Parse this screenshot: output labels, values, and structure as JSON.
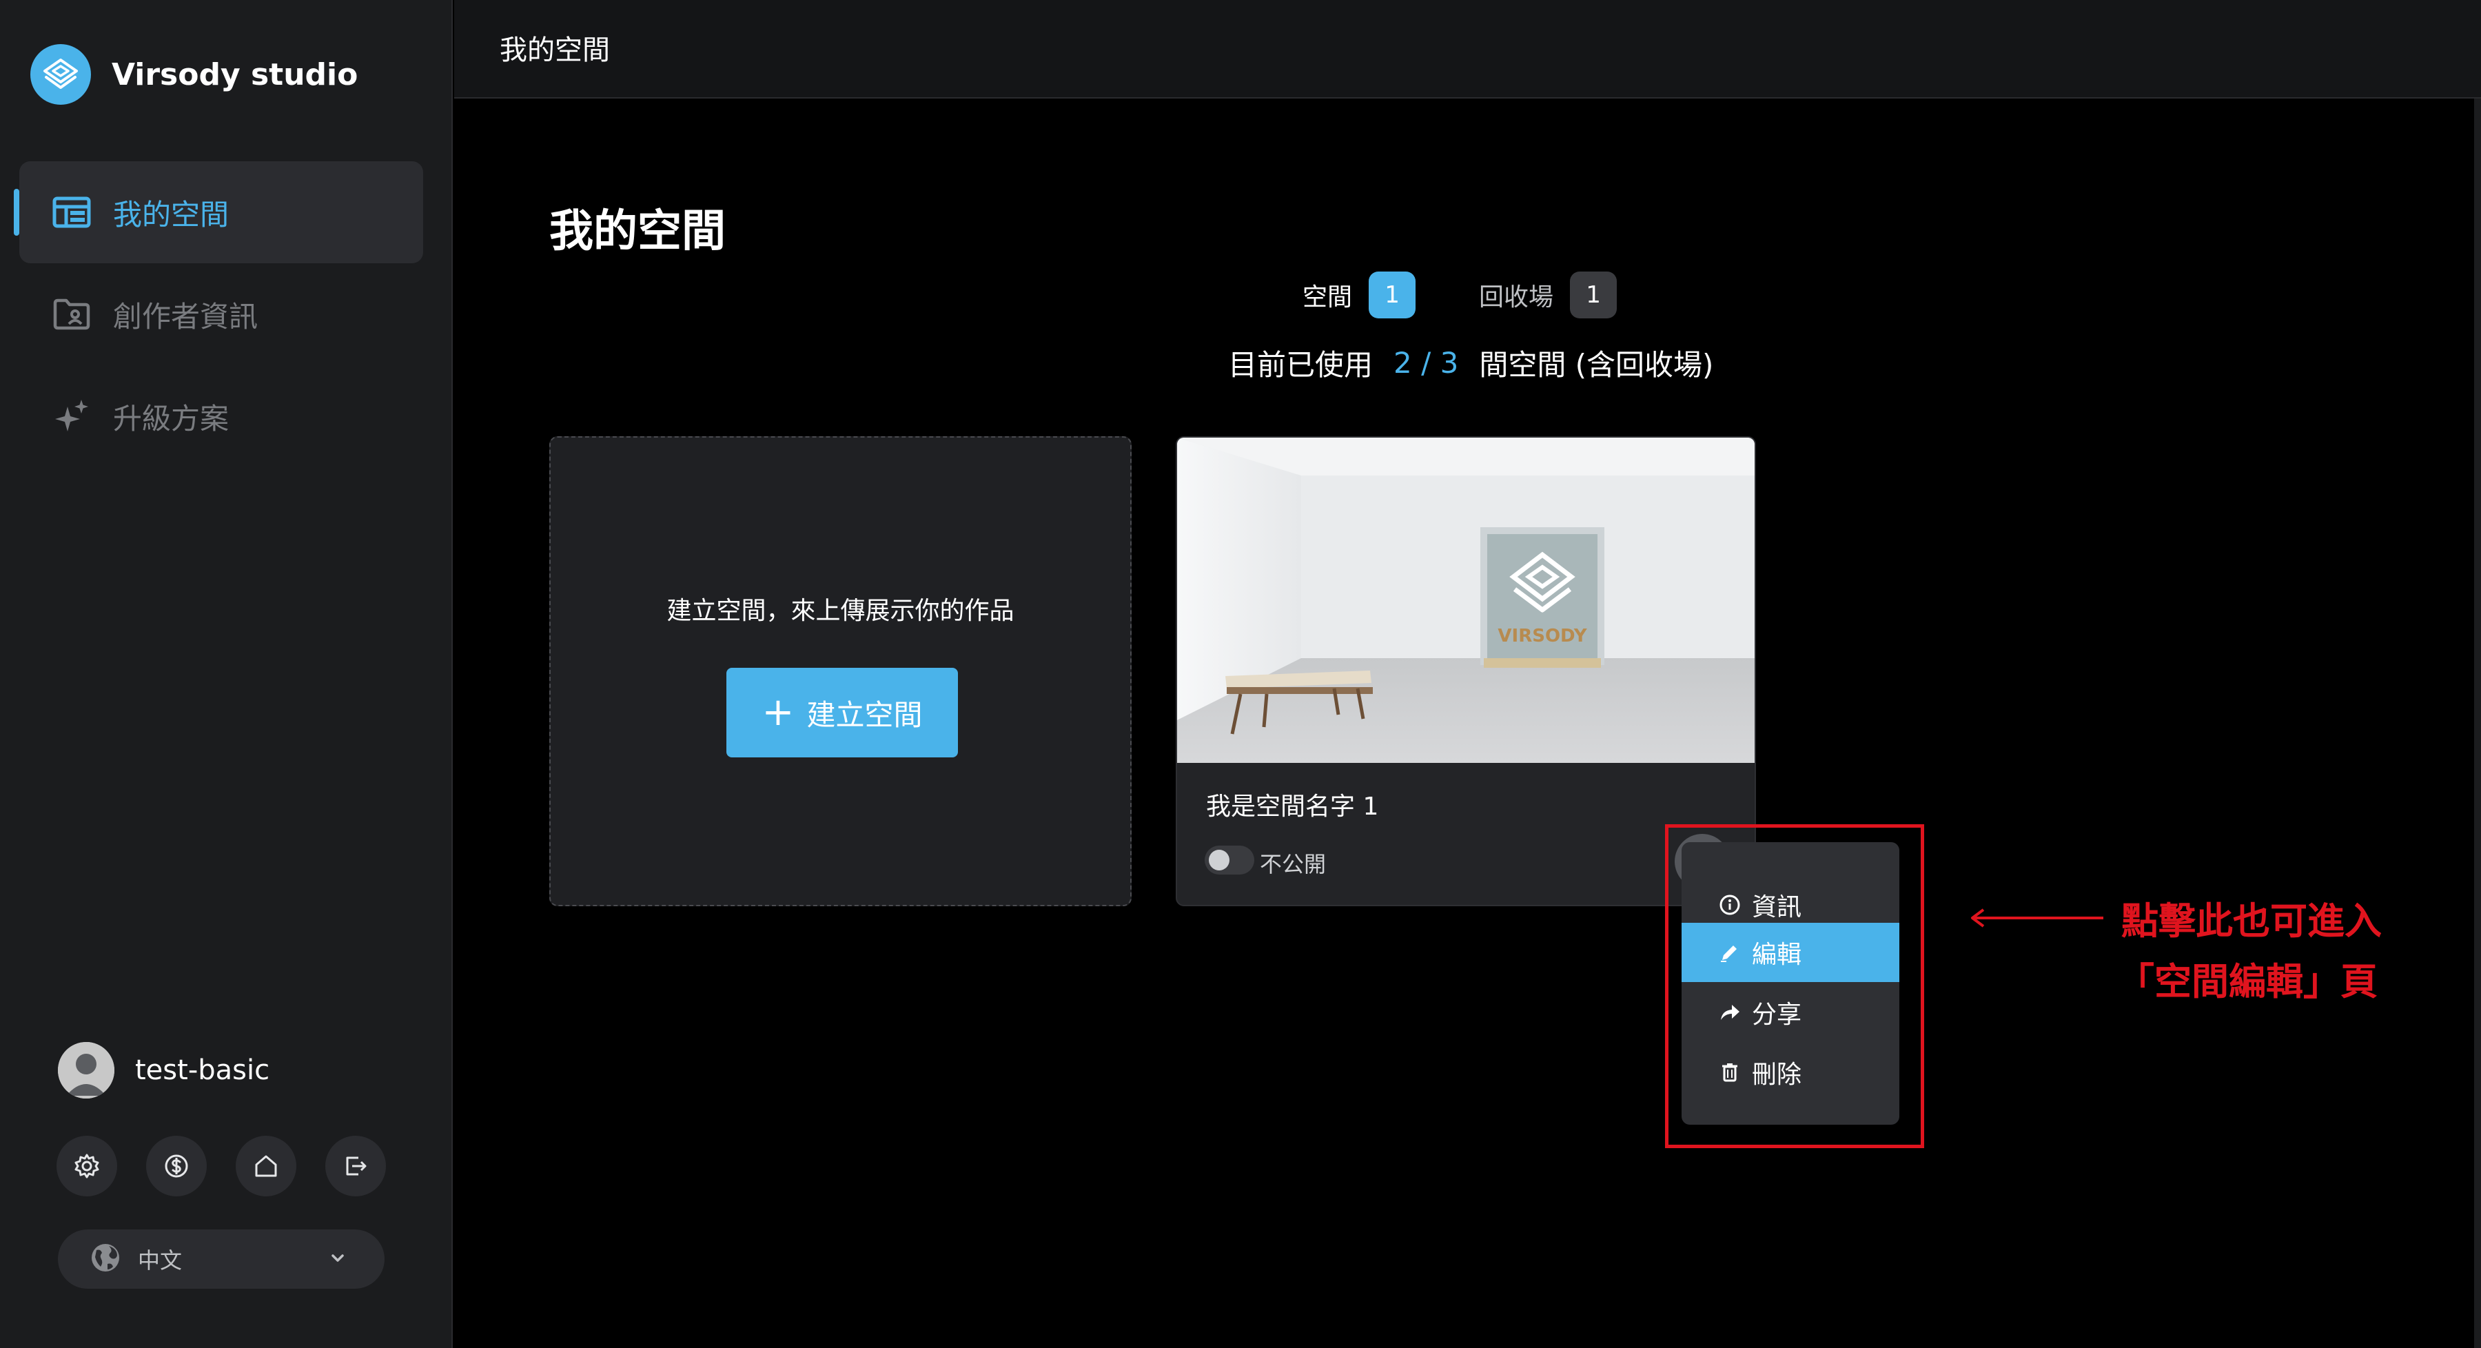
{
  "app": {
    "brand_name": "Virsody studio",
    "accent_color": "#4ab3ea",
    "annotation_color": "#e0141e"
  },
  "sidebar": {
    "items": [
      {
        "label": "我的空間",
        "icon": "space-dashboard-icon",
        "active": true
      },
      {
        "label": "創作者資訊",
        "icon": "folder-user-icon",
        "active": false
      },
      {
        "label": "升級方案",
        "icon": "sparkles-icon",
        "active": false
      }
    ],
    "user": {
      "name": "test-basic"
    },
    "tools": [
      "settings-icon",
      "dollar-icon",
      "home-icon",
      "logout-icon"
    ],
    "language": {
      "selected": "中文"
    }
  },
  "topbar": {
    "title": "我的空間"
  },
  "main": {
    "title": "我的空間",
    "tabs": [
      {
        "label": "空間",
        "count": "1",
        "active": true
      },
      {
        "label": "回收場",
        "count": "1",
        "active": false
      }
    ],
    "usage": {
      "prefix": "目前已使用",
      "value": "2 / 3",
      "suffix": "間空間 (含回收場)"
    },
    "create_card": {
      "text": "建立空間，來上傳展示你的作品",
      "button": "建立空間"
    },
    "space_card": {
      "name": "我是空間名字 1",
      "visibility": "不公開",
      "thumbnail_logo_text": "VIRSODY"
    }
  },
  "context_menu": {
    "items": [
      {
        "label": "資訊",
        "icon": "info-icon",
        "active": false
      },
      {
        "label": "編輯",
        "icon": "pencil-icon",
        "active": true
      },
      {
        "label": "分享",
        "icon": "share-arrow-icon",
        "active": false
      },
      {
        "label": "刪除",
        "icon": "trash-icon",
        "active": false
      }
    ]
  },
  "annotation": {
    "line1": "點擊此也可進入",
    "line2": "「空間編輯」頁"
  }
}
